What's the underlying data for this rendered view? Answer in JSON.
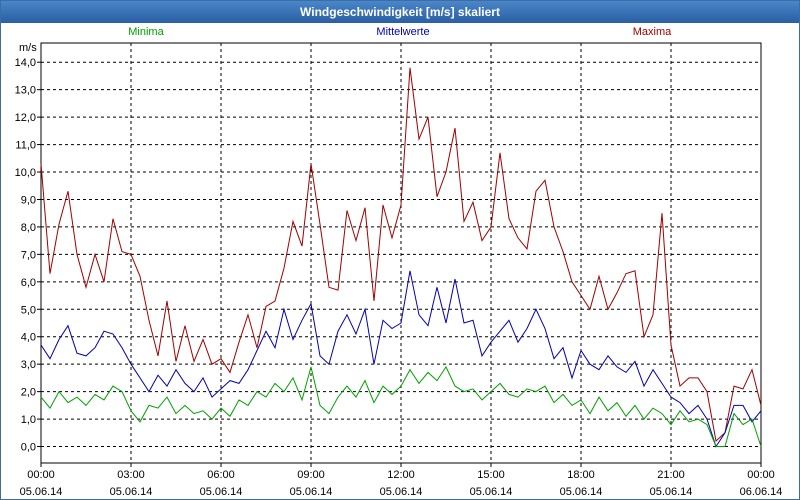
{
  "window": {
    "title": "Windgeschwindigkeit [m/s] skaliert"
  },
  "legend": {
    "minima": "Minima",
    "mittel": "Mittelwerte",
    "maxima": "Maxima"
  },
  "colors": {
    "minima": "#00a000",
    "mittel": "#0000b0",
    "maxima": "#a00000",
    "title_bg": "#2a5fa3"
  },
  "chart_data": {
    "type": "line",
    "title": "Windgeschwindigkeit [m/s] skaliert",
    "ylabel": "m/s",
    "xlabel": "",
    "ylim": [
      -0.6,
      14.7
    ],
    "xlim": [
      0,
      24
    ],
    "grid": true,
    "legend_position": "top",
    "y_ticks": [
      "0,0",
      "1,0",
      "2,0",
      "3,0",
      "4,0",
      "5,0",
      "6,0",
      "7,0",
      "8,0",
      "9,0",
      "10,0",
      "11,0",
      "12,0",
      "13,0",
      "14,0"
    ],
    "x_ticks": [
      {
        "time": "00:00",
        "date": "05.06.14"
      },
      {
        "time": "03:00",
        "date": "05.06.14"
      },
      {
        "time": "06:00",
        "date": "05.06.14"
      },
      {
        "time": "09:00",
        "date": "05.06.14"
      },
      {
        "time": "12:00",
        "date": "05.06.14"
      },
      {
        "time": "15:00",
        "date": "05.06.14"
      },
      {
        "time": "18:00",
        "date": "05.06.14"
      },
      {
        "time": "21:00",
        "date": "05.06.14"
      },
      {
        "time": "00:00",
        "date": "06.06.14"
      }
    ],
    "series": [
      {
        "name": "Maxima",
        "x": [
          0,
          0.3,
          0.6,
          0.9,
          1.2,
          1.5,
          1.8,
          2.1,
          2.4,
          2.7,
          3.0,
          3.3,
          3.6,
          3.9,
          4.2,
          4.5,
          4.8,
          5.1,
          5.4,
          5.7,
          6.0,
          6.3,
          6.6,
          6.9,
          7.2,
          7.5,
          7.8,
          8.1,
          8.4,
          8.7,
          9.0,
          9.3,
          9.6,
          9.9,
          10.2,
          10.5,
          10.8,
          11.1,
          11.4,
          11.7,
          12.0,
          12.3,
          12.6,
          12.9,
          13.2,
          13.5,
          13.8,
          14.1,
          14.4,
          14.7,
          15.0,
          15.3,
          15.6,
          15.9,
          16.2,
          16.5,
          16.8,
          17.1,
          17.4,
          17.7,
          18.0,
          18.3,
          18.6,
          18.9,
          19.2,
          19.5,
          19.8,
          20.1,
          20.4,
          20.7,
          21.0,
          21.3,
          21.6,
          21.9,
          22.2,
          22.5,
          22.8,
          23.1,
          23.4,
          23.7,
          24.0
        ],
        "values": [
          10.3,
          6.3,
          8.1,
          9.3,
          7.0,
          5.8,
          7.0,
          6.0,
          8.3,
          7.1,
          7.0,
          6.2,
          4.6,
          3.3,
          5.3,
          3.1,
          4.4,
          3.1,
          3.9,
          3.0,
          3.2,
          2.7,
          3.8,
          4.8,
          3.6,
          5.1,
          5.3,
          6.5,
          8.2,
          7.3,
          10.3,
          8.1,
          5.8,
          5.7,
          8.6,
          7.5,
          8.7,
          5.3,
          8.8,
          7.6,
          8.8,
          13.8,
          11.2,
          12.0,
          9.1,
          10.0,
          11.6,
          8.2,
          8.9,
          7.5,
          8.0,
          10.7,
          8.3,
          7.6,
          7.2,
          9.3,
          9.7,
          8.0,
          7.1,
          6.0,
          5.5,
          5.0,
          6.2,
          5.0,
          5.6,
          6.3,
          6.4,
          4.0,
          4.8,
          8.5,
          3.7,
          2.2,
          2.5,
          2.5,
          2.0,
          0.2,
          0.5,
          2.2,
          2.1,
          2.8,
          1.5
        ]
      },
      {
        "name": "Mittelwerte",
        "x": [
          0,
          0.3,
          0.6,
          0.9,
          1.2,
          1.5,
          1.8,
          2.1,
          2.4,
          2.7,
          3.0,
          3.3,
          3.6,
          3.9,
          4.2,
          4.5,
          4.8,
          5.1,
          5.4,
          5.7,
          6.0,
          6.3,
          6.6,
          6.9,
          7.2,
          7.5,
          7.8,
          8.1,
          8.4,
          8.7,
          9.0,
          9.3,
          9.6,
          9.9,
          10.2,
          10.5,
          10.8,
          11.1,
          11.4,
          11.7,
          12.0,
          12.3,
          12.6,
          12.9,
          13.2,
          13.5,
          13.8,
          14.1,
          14.4,
          14.7,
          15.0,
          15.3,
          15.6,
          15.9,
          16.2,
          16.5,
          16.8,
          17.1,
          17.4,
          17.7,
          18.0,
          18.3,
          18.6,
          18.9,
          19.2,
          19.5,
          19.8,
          20.1,
          20.4,
          20.7,
          21.0,
          21.3,
          21.6,
          21.9,
          22.2,
          22.5,
          22.8,
          23.1,
          23.4,
          23.7,
          24.0
        ],
        "values": [
          3.7,
          3.2,
          3.9,
          4.4,
          3.4,
          3.3,
          3.6,
          4.2,
          4.1,
          3.6,
          3.0,
          2.5,
          2.0,
          2.6,
          2.2,
          2.8,
          2.3,
          2.0,
          2.5,
          1.8,
          2.1,
          2.4,
          2.3,
          2.8,
          3.5,
          4.2,
          3.6,
          5.0,
          3.9,
          4.6,
          5.2,
          3.3,
          3.0,
          4.2,
          4.8,
          4.1,
          5.0,
          3.0,
          4.6,
          4.3,
          4.5,
          6.4,
          4.8,
          4.4,
          5.8,
          4.5,
          6.1,
          4.5,
          4.6,
          3.3,
          3.8,
          4.2,
          4.6,
          3.8,
          4.3,
          5.0,
          4.3,
          3.2,
          3.6,
          2.5,
          3.5,
          3.0,
          2.8,
          3.3,
          2.9,
          2.7,
          3.1,
          2.2,
          2.8,
          2.3,
          1.8,
          1.6,
          1.2,
          1.5,
          1.0,
          0.0,
          0.5,
          1.5,
          1.5,
          0.9,
          1.3
        ]
      },
      {
        "name": "Minima",
        "x": [
          0,
          0.3,
          0.6,
          0.9,
          1.2,
          1.5,
          1.8,
          2.1,
          2.4,
          2.7,
          3.0,
          3.3,
          3.6,
          3.9,
          4.2,
          4.5,
          4.8,
          5.1,
          5.4,
          5.7,
          6.0,
          6.3,
          6.6,
          6.9,
          7.2,
          7.5,
          7.8,
          8.1,
          8.4,
          8.7,
          9.0,
          9.3,
          9.6,
          9.9,
          10.2,
          10.5,
          10.8,
          11.1,
          11.4,
          11.7,
          12.0,
          12.3,
          12.6,
          12.9,
          13.2,
          13.5,
          13.8,
          14.1,
          14.4,
          14.7,
          15.0,
          15.3,
          15.6,
          15.9,
          16.2,
          16.5,
          16.8,
          17.1,
          17.4,
          17.7,
          18.0,
          18.3,
          18.6,
          18.9,
          19.2,
          19.5,
          19.8,
          20.1,
          20.4,
          20.7,
          21.0,
          21.3,
          21.6,
          21.9,
          22.2,
          22.5,
          22.8,
          23.1,
          23.4,
          23.7,
          24.0
        ],
        "values": [
          1.8,
          1.4,
          2.0,
          1.6,
          1.8,
          1.5,
          1.9,
          1.7,
          2.2,
          2.0,
          1.3,
          0.9,
          1.5,
          1.4,
          1.8,
          1.2,
          1.5,
          1.2,
          1.3,
          1.0,
          1.4,
          1.1,
          1.7,
          1.5,
          2.0,
          1.8,
          2.3,
          2.0,
          2.5,
          1.7,
          2.9,
          1.5,
          1.2,
          1.8,
          2.2,
          1.8,
          2.4,
          1.6,
          2.2,
          1.9,
          2.2,
          2.8,
          2.3,
          2.7,
          2.4,
          2.9,
          2.2,
          2.0,
          2.1,
          1.7,
          2.0,
          2.3,
          1.9,
          1.8,
          2.1,
          2.0,
          2.2,
          1.6,
          1.9,
          1.5,
          1.7,
          1.2,
          1.8,
          1.3,
          1.6,
          1.1,
          1.5,
          1.0,
          1.4,
          1.2,
          0.8,
          1.3,
          0.9,
          1.0,
          0.8,
          0.0,
          0.0,
          1.2,
          0.8,
          1.0,
          0.0
        ]
      }
    ]
  }
}
